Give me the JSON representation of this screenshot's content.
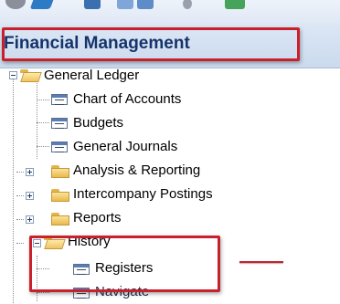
{
  "header": {
    "title": "Financial Management"
  },
  "tree": {
    "root": {
      "label": "General Ledger",
      "icon": "folder-open-icon"
    },
    "items": [
      {
        "label": "Chart of Accounts",
        "icon": "list-page-icon"
      },
      {
        "label": "Budgets",
        "icon": "list-page-icon"
      },
      {
        "label": "General Journals",
        "icon": "list-page-icon"
      },
      {
        "label": "Analysis & Reporting",
        "icon": "folder-icon"
      },
      {
        "label": "Intercompany Postings",
        "icon": "folder-icon"
      },
      {
        "label": "Reports",
        "icon": "folder-icon"
      },
      {
        "label": "History",
        "icon": "folder-open-icon"
      },
      {
        "label": "Registers",
        "icon": "list-page-icon"
      },
      {
        "label": "Navigate",
        "icon": "list-page-icon"
      }
    ]
  },
  "colors": {
    "highlight": "#c9212b",
    "header_text": "#15346b",
    "header_bg": "#cbdaee"
  }
}
